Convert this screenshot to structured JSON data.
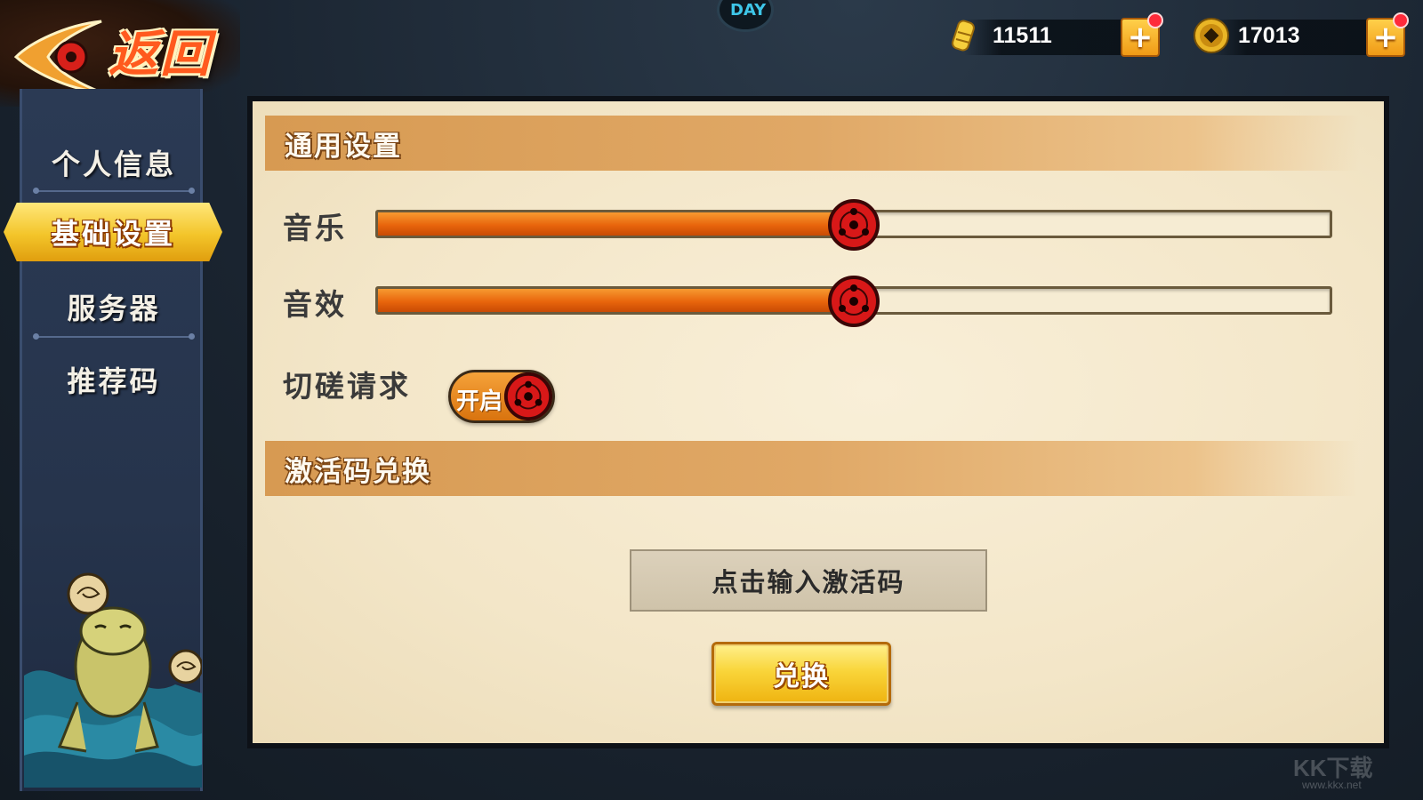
{
  "header": {
    "back_label": "返回",
    "badge_text": "DAY"
  },
  "currencies": [
    {
      "name": "gold-bars",
      "amount": "11511",
      "plus": "+"
    },
    {
      "name": "coins",
      "amount": "17013",
      "plus": "+"
    }
  ],
  "sidebar": {
    "items": [
      {
        "label": "个人信息",
        "active": false
      },
      {
        "label": "基础设置",
        "active": true
      },
      {
        "label": "服务器",
        "active": false
      },
      {
        "label": "推荐码",
        "active": false
      }
    ]
  },
  "general": {
    "title": "通用设置",
    "music_label": "音乐",
    "music_level": 0.5,
    "sfx_label": "音效",
    "sfx_level": 0.5,
    "duel_label": "切磋请求",
    "duel_toggle_text": "开启",
    "duel_enabled": true
  },
  "activation": {
    "title": "激活码兑换",
    "input_placeholder": "点击输入激活码",
    "redeem_label": "兑换"
  },
  "watermark": {
    "text": "KK下载",
    "sub": "www.kkx.net"
  },
  "colors": {
    "accent_orange": "#e8650c",
    "active_tab_gold": "#f3c52a",
    "panel_bg": "#f3e6c8",
    "sidebar_bg": "#26344c"
  }
}
